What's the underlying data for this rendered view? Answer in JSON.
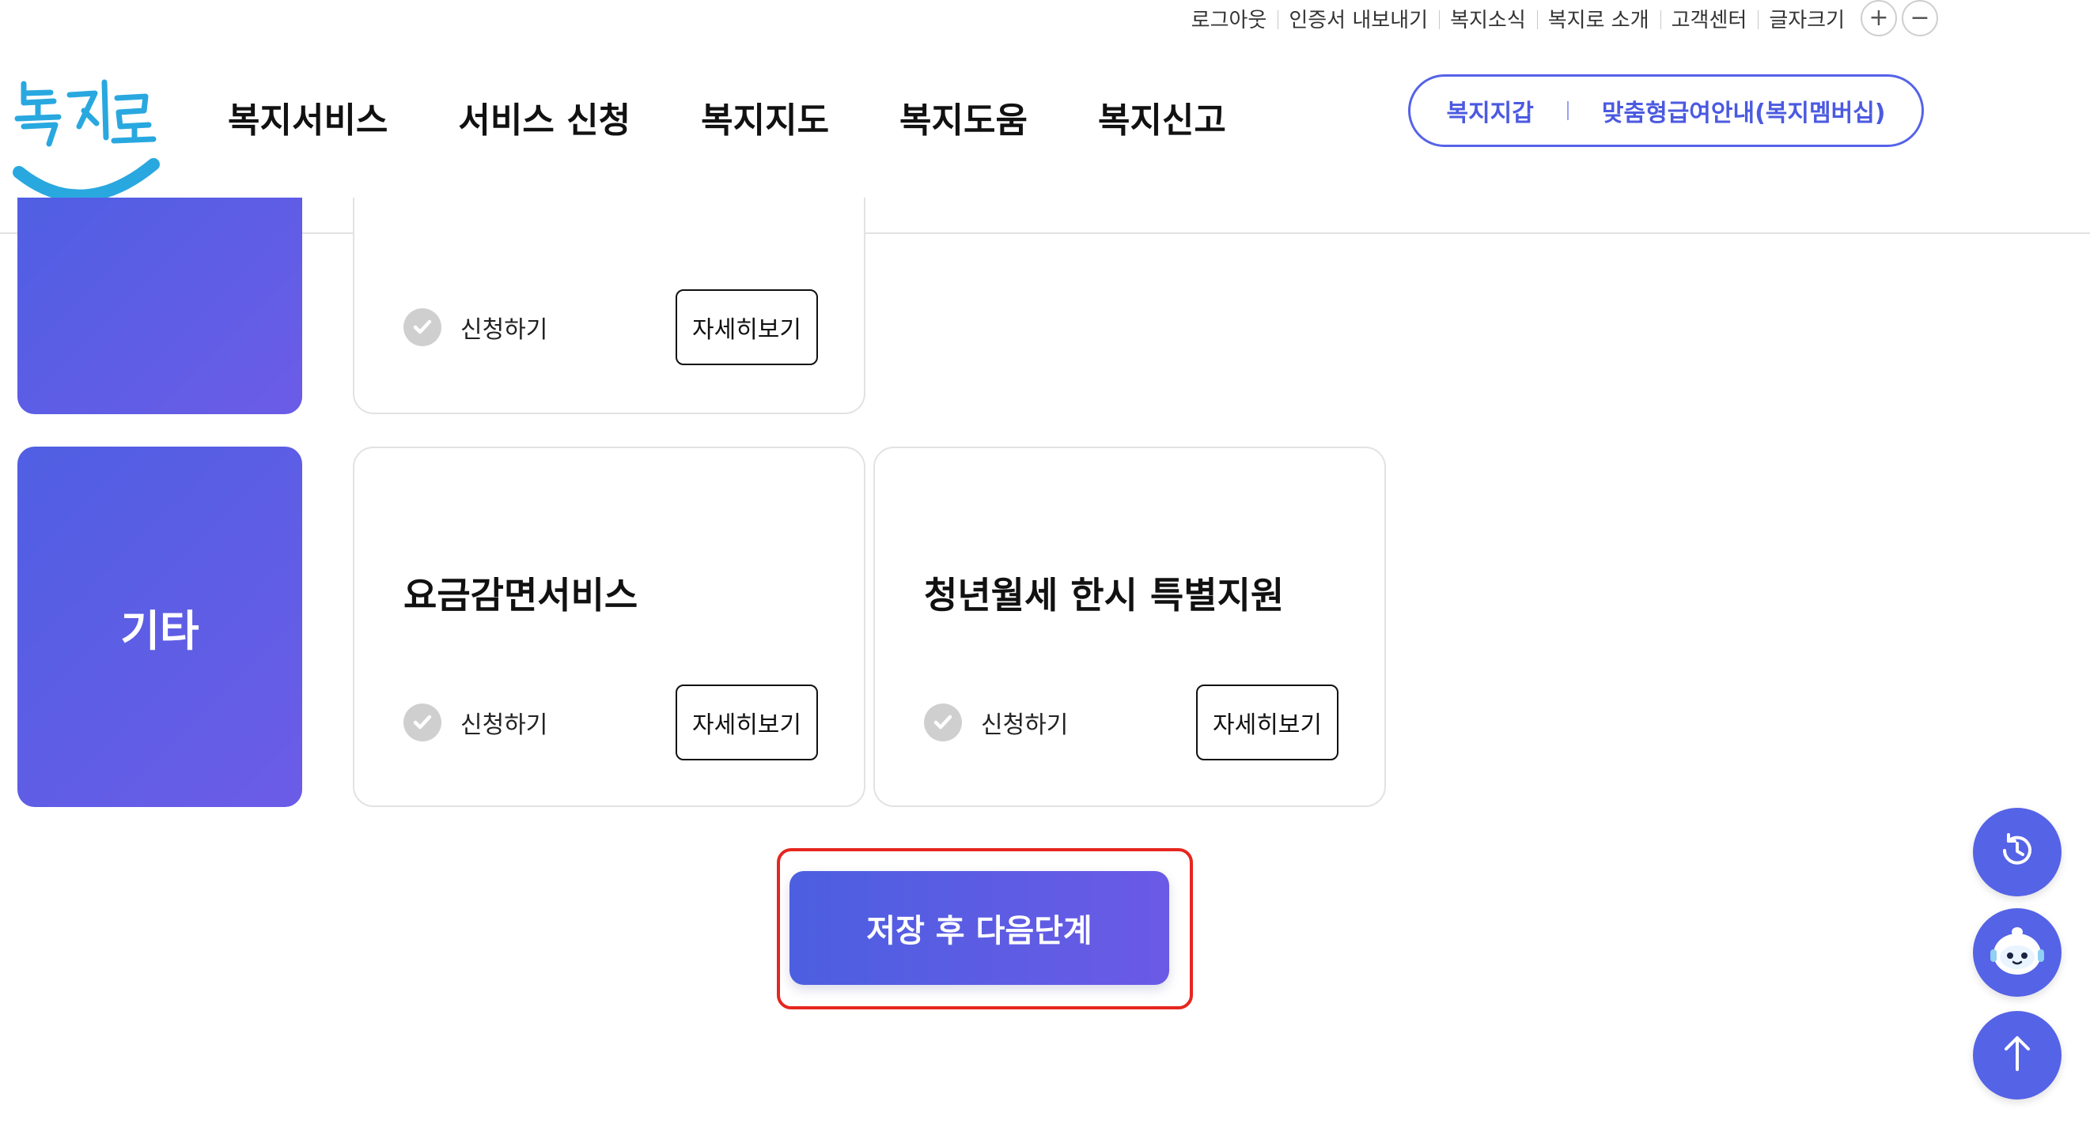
{
  "utility_bar": {
    "links": [
      "로그아웃",
      "인증서 내보내기",
      "복지소식",
      "복지로 소개",
      "고객센터",
      "글자크기"
    ],
    "font_increase": "+",
    "font_decrease": "−"
  },
  "header": {
    "logo_text": "복지로",
    "gnb": [
      "복지서비스",
      "서비스 신청",
      "복지지도",
      "복지도움",
      "복지신고"
    ],
    "pill": {
      "wallet": "복지지갑",
      "membership": "맞춤형급여안내(복지멤버십)"
    }
  },
  "sections": [
    {
      "category": "",
      "cards": [
        {
          "title": "",
          "apply_label": "신청하기",
          "detail_label": "자세히보기"
        }
      ]
    },
    {
      "category": "기타",
      "cards": [
        {
          "title": "요금감면서비스",
          "apply_label": "신청하기",
          "detail_label": "자세히보기"
        },
        {
          "title": "청년월세 한시 특별지원",
          "apply_label": "신청하기",
          "detail_label": "자세히보기"
        }
      ]
    }
  ],
  "next_button": "저장 후 다음단계",
  "floating": {
    "history_icon": "history-icon",
    "chatbot_icon": "chatbot-icon",
    "top_icon": "arrow-up-icon"
  },
  "colors": {
    "accent": "#5563e6",
    "gradient_start": "#4f5fe3",
    "gradient_end": "#6c5ce7",
    "highlight": "#e5261f",
    "logo_blue": "#29a8e0"
  }
}
